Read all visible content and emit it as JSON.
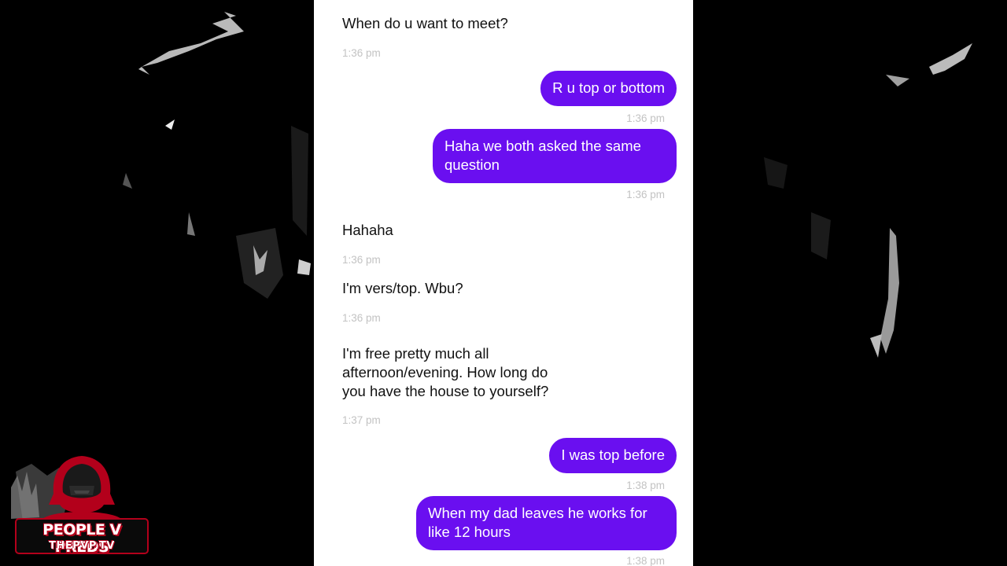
{
  "conversation": {
    "messages": [
      {
        "direction": "in",
        "text": "When do u want to meet?",
        "time": "1:36 pm"
      },
      {
        "direction": "out",
        "text": "R u top or bottom",
        "time": "1:36 pm"
      },
      {
        "direction": "out",
        "text": "Haha we both asked the same\nquestion",
        "time": "1:36 pm"
      },
      {
        "direction": "in",
        "text": "Hahaha",
        "time": "1:36 pm"
      },
      {
        "direction": "in",
        "text": "I'm vers/top. Wbu?",
        "time": "1:36 pm"
      },
      {
        "direction": "in",
        "text": "I'm free pretty much all\nafternoon/evening. How long do\nyou have the house to yourself?",
        "time": "1:37 pm"
      },
      {
        "direction": "out",
        "text": "I was top before",
        "time": "1:38 pm"
      },
      {
        "direction": "out",
        "text": "When my dad leaves he works for\nlike 12 hours",
        "time": "1:38 pm"
      }
    ]
  },
  "watermark": {
    "title": "PEOPLE V PREDS",
    "site": "THEPVP.TV"
  },
  "colors": {
    "outgoing_bubble": "#6a0ff0",
    "timestamp": "#c3c3c3",
    "incoming_text": "#111111",
    "logo_red": "#b3001b"
  }
}
